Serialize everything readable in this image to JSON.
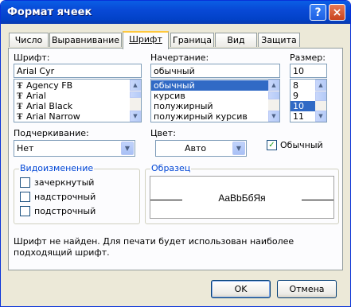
{
  "window": {
    "title": "Формат ячеек",
    "help_glyph": "?",
    "close_glyph": "×"
  },
  "tabs": [
    {
      "label": "Число"
    },
    {
      "label": "Выравнивание"
    },
    {
      "label": "Шрифт"
    },
    {
      "label": "Граница"
    },
    {
      "label": "Вид"
    },
    {
      "label": "Защита"
    }
  ],
  "font": {
    "label": "Шрифт:",
    "value": "Arial Cyr",
    "items": [
      "Agency FB",
      "Arial",
      "Arial Black",
      "Arial Narrow"
    ],
    "icon_glyph": "Ŧ"
  },
  "style": {
    "label": "Начертание:",
    "value": "обычный",
    "items": [
      "обычный",
      "курсив",
      "полужирный",
      "полужирный курсив"
    ],
    "selected_index": 0
  },
  "size": {
    "label": "Размер:",
    "value": "10",
    "items": [
      "8",
      "9",
      "10",
      "11"
    ],
    "selected_index": 2
  },
  "underline": {
    "label": "Подчеркивание:",
    "value": "Нет"
  },
  "color": {
    "label": "Цвет:",
    "value": "Авто"
  },
  "normal": {
    "label": "Обычный",
    "checked": true
  },
  "effects": {
    "title": "Видоизменение",
    "items": [
      "зачеркнутый",
      "надстрочный",
      "подстрочный"
    ]
  },
  "preview": {
    "title": "Образец",
    "text": "AaBbБбЯя"
  },
  "message": "Шрифт не найден. Для печати будет использован наиболее подходящий шрифт.",
  "buttons": {
    "ok": "OK",
    "cancel": "Отмена"
  }
}
